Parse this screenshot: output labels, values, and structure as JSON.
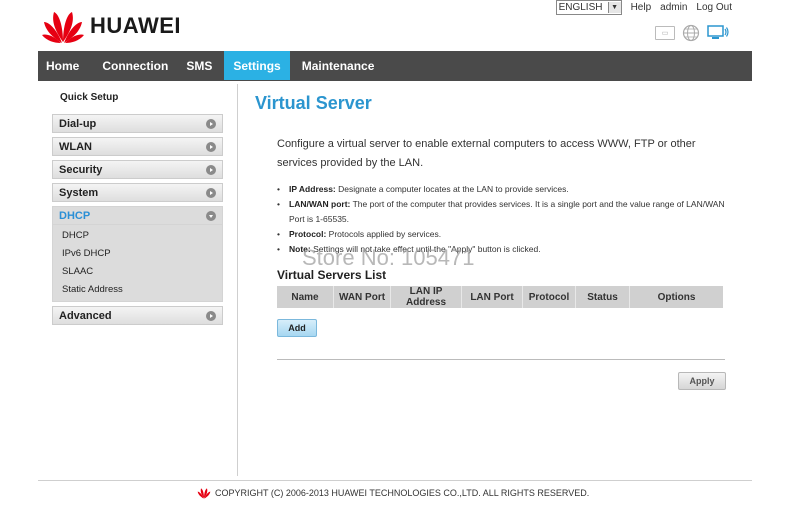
{
  "brand": {
    "name": "HUAWEI",
    "color": "#e60012"
  },
  "topbar": {
    "language": "ENGLISH",
    "links": [
      "Help",
      "admin",
      "Log Out"
    ]
  },
  "status_icons": [
    "sim-icon",
    "globe-icon",
    "computer-icon"
  ],
  "nav": {
    "items": [
      "Home",
      "Connection",
      "SMS",
      "Settings",
      "Maintenance"
    ],
    "active": "Settings",
    "active_color": "#2bb1e4"
  },
  "sidebar": {
    "quick_setup": "Quick Setup",
    "items": [
      "Dial-up",
      "WLAN",
      "Security",
      "System",
      "DHCP",
      "Advanced"
    ],
    "open_item": "DHCP",
    "dhcp_subitems": [
      "DHCP",
      "IPv6 DHCP",
      "SLAAC",
      "Static Address"
    ]
  },
  "main": {
    "title": "Virtual Server",
    "description": "Configure a virtual server to enable external computers to access WWW, FTP or other services provided by the LAN.",
    "bullets": [
      {
        "label": "IP Address:",
        "text": " Designate a computer locates at the LAN to provide services."
      },
      {
        "label": "LAN/WAN port:",
        "text": " The port of the computer that provides services. It is a single port and the value range of LAN/WAN Port is 1-65535."
      },
      {
        "label": "Protocol:",
        "text": " Protocols applied by services."
      },
      {
        "label": "Note:",
        "text": " Settings will not take effect until the \"Apply\" button is clicked."
      }
    ],
    "list_title": "Virtual Servers List",
    "table_headers": [
      "Name",
      "WAN Port",
      "LAN IP Address",
      "LAN Port",
      "Protocol",
      "Status",
      "Options"
    ],
    "add_button": "Add",
    "apply_button": "Apply"
  },
  "watermark": "Store No: 105471",
  "footer": "COPYRIGHT (C) 2006-2013 HUAWEI TECHNOLOGIES CO.,LTD. ALL RIGHTS RESERVED."
}
